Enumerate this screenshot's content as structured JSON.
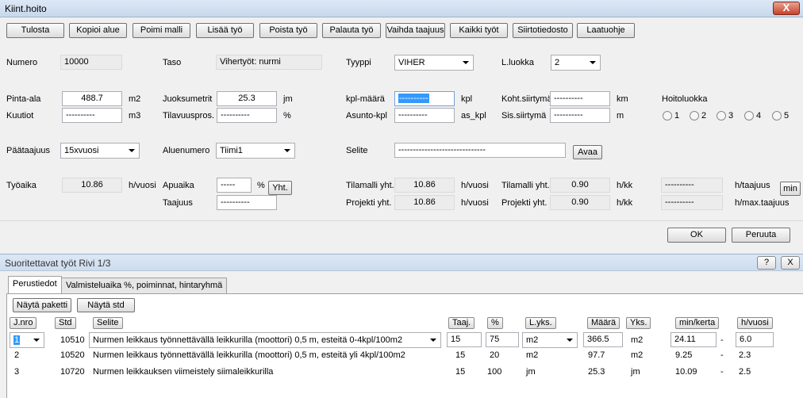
{
  "window": {
    "title": "Kiint.hoito",
    "close_glyph": "X"
  },
  "toolbar": [
    "Tulosta",
    "Kopioi alue",
    "Poimi malli",
    "Lisää työ",
    "Poista työ",
    "Palauta työ",
    "Vaihda taajuus",
    "Kaikki työt",
    "Siirtotiedosto",
    "Laatuohje"
  ],
  "form": {
    "numero_label": "Numero",
    "numero": "10000",
    "taso_label": "Taso",
    "taso": "Vihertyöt: nurmi",
    "tyyppi_label": "Tyyppi",
    "tyyppi": "VIHER",
    "lluokka_label": "L.luokka",
    "lluokka": "2",
    "pinta_ala_label": "Pinta-ala",
    "pinta_ala": "488.7",
    "pinta_ala_unit": "m2",
    "kuutiot_label": "Kuutiot",
    "kuutiot": "----------",
    "kuutiot_unit": "m3",
    "juoksumetrit_label": "Juoksumetrit",
    "juoksumetrit": "25.3",
    "juoksumetrit_unit": "jm",
    "tilavuuspros_label": "Tilavuuspros.",
    "tilavuuspros": "----------",
    "tilavuuspros_unit": "%",
    "kpl_maara_label": "kpl-määrä",
    "kpl_maara": "----------",
    "kpl_maara_unit": "kpl",
    "asunto_kpl_label": "Asunto-kpl",
    "asunto_kpl": "----------",
    "asunto_kpl_unit": "as_kpl",
    "koht_siirtyma_label": "Koht.siirtymä",
    "koht_siirtyma": "----------",
    "koht_siirtyma_unit": "km",
    "sis_siirtyma_label": "Sis.siirtymä",
    "sis_siirtyma": "----------",
    "sis_siirtyma_unit": "m",
    "hoitoluokka_label": "Hoitoluokka",
    "hoitoluokka_options": [
      "1",
      "2",
      "3",
      "4",
      "5"
    ],
    "paataajuus_label": "Päätaajuus",
    "paataajuus": "15xvuosi",
    "aluenumero_label": "Aluenumero",
    "aluenumero": "Tiimi1",
    "selite_label": "Selite",
    "selite": "------------------------------",
    "avaa_label": "Avaa",
    "tyoaika_label": "Työaika",
    "tyoaika": "10.86",
    "tyoaika_unit": "h/vuosi",
    "apuaika_label": "Apuaika",
    "apuaika": "-----",
    "apuaika_unit": "%",
    "yht_label": "Yht.",
    "taajuus_label": "Taajuus",
    "taajuus": "----------",
    "tilamalli_yht_label": "Tilamalli yht.",
    "tilamalli_yht": "10.86",
    "tilamalli_yht_unit": "h/vuosi",
    "projekti_yht_label": "Projekti yht.",
    "projekti_yht": "10.86",
    "projekti_yht_unit": "h/vuosi",
    "tilamalli_yht2_label": "Tilamalli yht.",
    "tilamalli_yht2": "0.90",
    "tilamalli_yht2_unit": "h/kk",
    "projekti_yht2_label": "Projekti yht.",
    "projekti_yht2": "0.90",
    "projekti_yht2_unit": "h/kk",
    "h_taajuus_value": "----------",
    "h_taajuus_unit": "h/taajuus",
    "h_max_value": "----------",
    "h_max_unit": "h/max.taajuus",
    "min_label": "min",
    "ok_label": "OK",
    "cancel_label": "Peruuta"
  },
  "works": {
    "title": "Suoritettavat työt   Rivi 1/3",
    "help_glyph": "?",
    "close_glyph": "X",
    "tabs": [
      "Perustiedot",
      "Valmisteluaika %, poiminnat, hintaryhmä"
    ],
    "buttons": [
      "Näytä paketti",
      "Näytä std"
    ],
    "columns": [
      "J.nro",
      "Std",
      "Selite",
      "Taaj.",
      "%",
      "L.yks.",
      "Määrä",
      "Yks.",
      "min/kerta",
      "h/vuosi"
    ],
    "rows": [
      [
        "1",
        "10510",
        "Nurmen leikkaus työnnettävällä leikkurilla (moottori) 0,5 m, esteitä 0-4kpl/100m2",
        "15",
        "75",
        "m2",
        "366.5",
        "m2",
        "24.11",
        "-",
        "6.0"
      ],
      [
        "2",
        "10520",
        "Nurmen leikkaus työnnettävällä leikkurilla (moottori) 0,5 m, esteitä yli 4kpl/100m2",
        "15",
        "20",
        "m2",
        "97.7",
        "m2",
        "9.25",
        "-",
        "2.3"
      ],
      [
        "3",
        "10720",
        "Nurmen leikkauksen viimeistely siimaleikkurilla",
        "15",
        "100",
        "jm",
        "25.3",
        "jm",
        "10.09",
        "-",
        "2.5"
      ]
    ]
  }
}
